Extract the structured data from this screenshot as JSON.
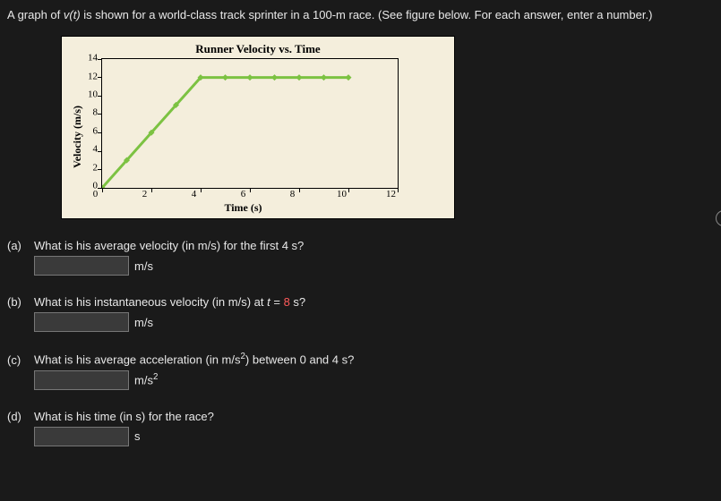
{
  "prompt": {
    "pre": "A graph of ",
    "vt": "v(t)",
    "post": " is shown for a world-class track sprinter in a 100-m race. (See figure below. For each answer, enter a number.)"
  },
  "chart_data": {
    "type": "line",
    "title": "Runner Velocity vs. Time",
    "xlabel": "Time (s)",
    "ylabel": "Velocity (m/s)",
    "xlim": [
      0,
      12
    ],
    "ylim": [
      0,
      14
    ],
    "xticks": [
      0,
      2,
      4,
      6,
      8,
      10,
      12
    ],
    "yticks": [
      0,
      2,
      4,
      6,
      8,
      10,
      12,
      14
    ],
    "x": [
      0,
      1,
      2,
      3,
      4,
      5,
      6,
      7,
      8,
      9,
      10
    ],
    "y": [
      0,
      3,
      6,
      9,
      12,
      12,
      12,
      12,
      12,
      12,
      12
    ],
    "markers": true,
    "line_color": "#7cc242"
  },
  "questions": {
    "a": {
      "label": "(a)",
      "text": "What is his average velocity (in m/s) for the first 4 s?",
      "unit": "m/s"
    },
    "b": {
      "label": "(b)",
      "pre": "What is his instantaneous velocity (in m/s) at ",
      "tvar": "t",
      "eq": " = ",
      "tval": "8",
      "post": " s?",
      "unit": "m/s"
    },
    "c": {
      "label": "(c)",
      "text_pre": "What is his average acceleration (in m/s",
      "sup": "2",
      "text_post": ") between 0 and 4 s?",
      "unit_pre": "m/s",
      "unit_sup": "2"
    },
    "d": {
      "label": "(d)",
      "text": "What is his time (in s) for the race?",
      "unit": "s"
    }
  },
  "info_icon": "i"
}
